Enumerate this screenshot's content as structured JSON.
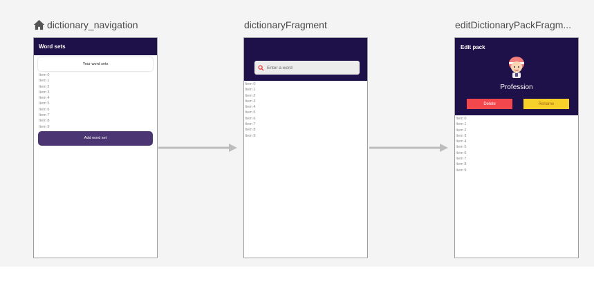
{
  "screens": [
    {
      "caption": "dictionary_navigation",
      "is_start": true,
      "appbar_title": "Word sets",
      "header_text": "Your word sets",
      "items": [
        "Item 0",
        "Item 1",
        "Item 2",
        "Item 3",
        "Item 4",
        "Item 5",
        "Item 6",
        "Item 7",
        "Item 8",
        "Item 9"
      ],
      "button_label": "Add word set"
    },
    {
      "caption": "dictionaryFragment",
      "search_placeholder": "Enter a word",
      "items": [
        "Item 0",
        "Item 1",
        "Item 2",
        "Item 3",
        "Item 4",
        "Item 5",
        "Item 6",
        "Item 7",
        "Item 8",
        "Item 9"
      ]
    },
    {
      "caption": "editDictionaryPackFragm...",
      "appbar_title": "Edit pack",
      "pack_name": "Profession",
      "delete_label": "Delete",
      "rename_label": "Rename",
      "items": [
        "Item 0",
        "Item 1",
        "Item 2",
        "Item 3",
        "Item 4",
        "Item 5",
        "Item 6",
        "Item 7",
        "Item 8",
        "Item 9"
      ]
    }
  ],
  "colors": {
    "appbar": "#1e1048",
    "primary_button": "#4b3673",
    "delete": "#f2474c",
    "rename": "#f7d12a",
    "arrow": "#bdbdbd"
  },
  "icons": {
    "start": "home-icon",
    "search": "search-icon",
    "avatar": "avatar-icon"
  }
}
